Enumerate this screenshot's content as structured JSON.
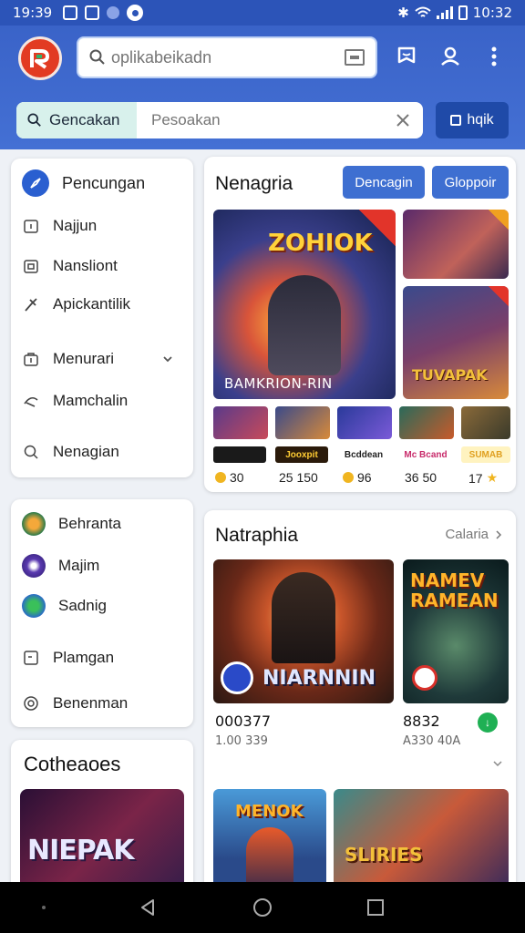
{
  "status_bar": {
    "time_left": "19:39",
    "time_right": "10:32"
  },
  "header": {
    "search_placeholder": "oplikabeikadn",
    "filter_tab_label": "Gencakan",
    "filter_placeholder": "Pesoakan",
    "action_button_label": "hqik"
  },
  "sidebar": {
    "items": [
      {
        "label": "Pencungan",
        "icon": "compass-icon"
      },
      {
        "label": "Najjun",
        "icon": "music-icon"
      },
      {
        "label": "Nansliont",
        "icon": "store-icon"
      },
      {
        "label": "Apickantilik",
        "icon": "tools-icon"
      },
      {
        "label": "Menurari",
        "icon": "bag-icon"
      },
      {
        "label": "Mamchalin",
        "icon": "hat-icon"
      },
      {
        "label": "Nenagian",
        "icon": "search-icon"
      }
    ]
  },
  "categories": {
    "items": [
      {
        "label": "Behranta"
      },
      {
        "label": "Majim"
      },
      {
        "label": "Sadnig"
      },
      {
        "label": "Plamgan"
      },
      {
        "label": "Benenman"
      }
    ]
  },
  "featured": {
    "title": "Cotheaoes",
    "game_title": "NIEPAK"
  },
  "top_section": {
    "title": "Nenagria",
    "button1": "Dencagin",
    "button2": "Gloppoir",
    "hero_title": "ZOHIOK",
    "hero_subtitle": "BAMKRION-RIN",
    "side_title": "TUVAPAK",
    "thumb_labels": [
      "",
      "Jooxpit",
      "Bcddean",
      "Mc Bcand",
      "SUMAB"
    ],
    "stats": [
      "30",
      "25 150",
      "96",
      "36 50",
      "17"
    ]
  },
  "second_section": {
    "title": "Natraphia",
    "link": "Calaria",
    "game1_title": "NIARNNIN",
    "game2_title": "NAMEV RAMEAN",
    "game1_stat": "000377",
    "game1_sub": "1.00 339",
    "game2_stat": "8832",
    "game2_sub": "A330 40A",
    "game3_title": "MENOK",
    "game4_title": "SLIRIES"
  },
  "colors": {
    "header_blue": "#3a63c8",
    "accent_blue": "#3e6fd1",
    "logo_red": "#e23b22"
  }
}
